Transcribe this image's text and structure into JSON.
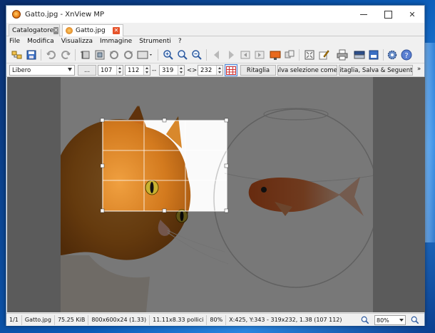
{
  "window": {
    "title": "Gatto.jpg - XnView MP"
  },
  "tabs": [
    {
      "label": "Catalogatore"
    },
    {
      "label": "Gatto.jpg"
    }
  ],
  "menu": [
    "File",
    "Modifica",
    "Visualizza",
    "Immagine",
    "Strumenti",
    "?"
  ],
  "toolbar": {
    "icons": [
      "browse-icon",
      "save-icon",
      "undo-icon",
      "redo-icon",
      "crop-icon",
      "resize-icon",
      "rotate-left-icon",
      "rotate-right-icon",
      "slideshow-icon",
      "zoom-in-icon",
      "zoom-fit-icon",
      "zoom-out-icon",
      "previous-icon",
      "next-icon",
      "first-icon",
      "last-icon",
      "wallpaper-icon",
      "compare-icon",
      "fullscreen-icon",
      "edit-icon",
      "print-icon",
      "scanner-icon",
      "batch-icon",
      "settings-icon",
      "help-icon"
    ]
  },
  "crop_options": {
    "ratio_value": "Libero",
    "ellipsis_label": "...",
    "x": "107",
    "y": "112",
    "separator": "--",
    "width": "319",
    "swap_symbol": "<>",
    "height": "232",
    "crop_label": "Ritaglia",
    "save_selection_label": "Salva selezione come...",
    "crop_save_next_label": "Ritaglia, Salva & Seguente",
    "overflow": "»"
  },
  "status": {
    "index": "1/1",
    "filename": "Gatto.jpg",
    "filesize": "75.25 KiB",
    "dimensions": "800x600x24 (1.33)",
    "print_size": "11.11x8.33 pollici",
    "zoom_percent": "80%",
    "selection_info": "X:425, Y:343 - 319x232, 1.38 (107 112)",
    "zoom_value": "80%"
  },
  "colors": {
    "accent": "#e6532a",
    "selection_border": "#ffffff",
    "desktop": "#0b5cb8"
  }
}
